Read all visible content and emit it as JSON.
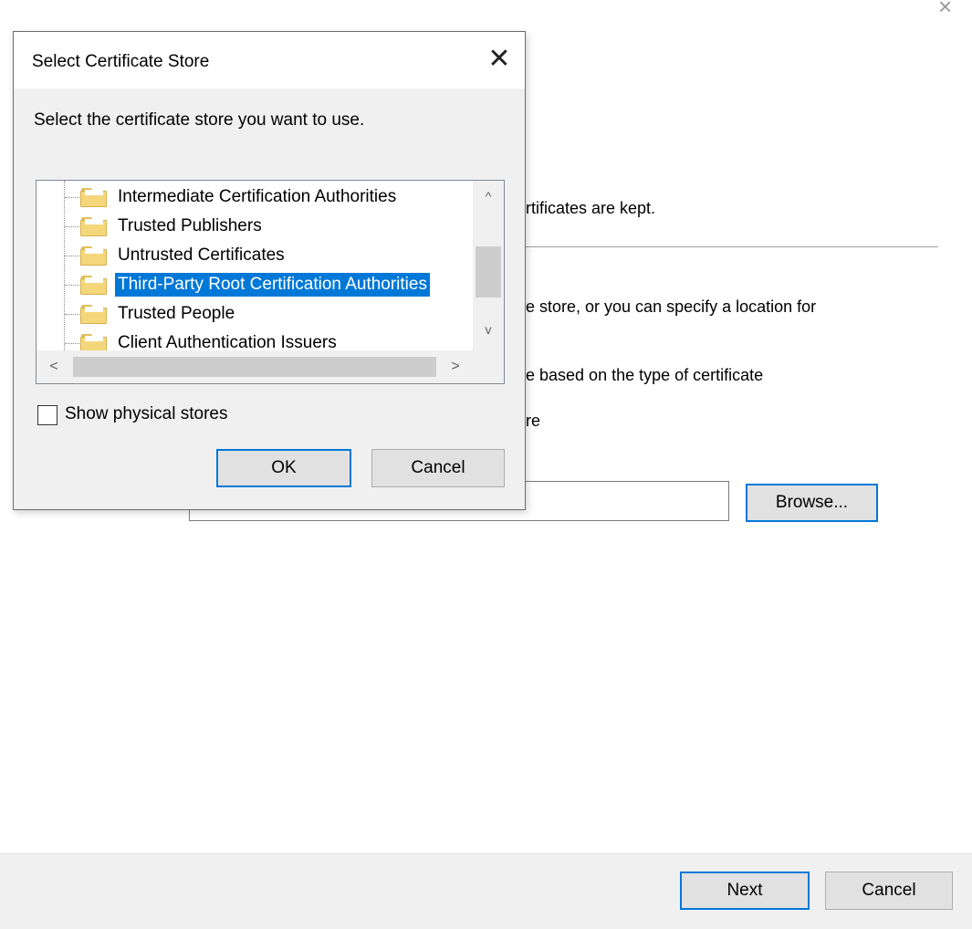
{
  "wizard": {
    "close_glyph": "×",
    "line_kept": "rtificates are kept.",
    "line_store": "e store, or you can specify a location for",
    "line_based": "e based on the type of certificate",
    "line_re": "re",
    "browse_label": "Browse...",
    "next_label": "Next",
    "cancel_label": "Cancel"
  },
  "dialog": {
    "title": "Select Certificate Store",
    "close_glyph": "✕",
    "prompt": "Select the certificate store you want to use.",
    "tree_items": [
      {
        "label": "Intermediate Certification Authorities",
        "icon": "folder-icon",
        "selected": false
      },
      {
        "label": "Trusted Publishers",
        "icon": "folder-icon",
        "selected": false
      },
      {
        "label": "Untrusted Certificates",
        "icon": "folder-icon",
        "selected": false
      },
      {
        "label": "Third-Party Root Certification Authorities",
        "icon": "folder-icon",
        "selected": true
      },
      {
        "label": "Trusted People",
        "icon": "folder-icon",
        "selected": false
      },
      {
        "label": "Client Authentication Issuers",
        "icon": "folder-icon",
        "selected": false
      }
    ],
    "scroll_up_glyph": "^",
    "scroll_down_glyph": "v",
    "scroll_left_glyph": "<",
    "scroll_right_glyph": ">",
    "show_physical_stores_label": "Show physical stores",
    "show_physical_stores_checked": false,
    "ok_label": "OK",
    "cancel_label": "Cancel"
  },
  "colors": {
    "selection": "#0078d7",
    "dialog_bg": "#f0f0f0",
    "folder": "#f5d77b"
  }
}
